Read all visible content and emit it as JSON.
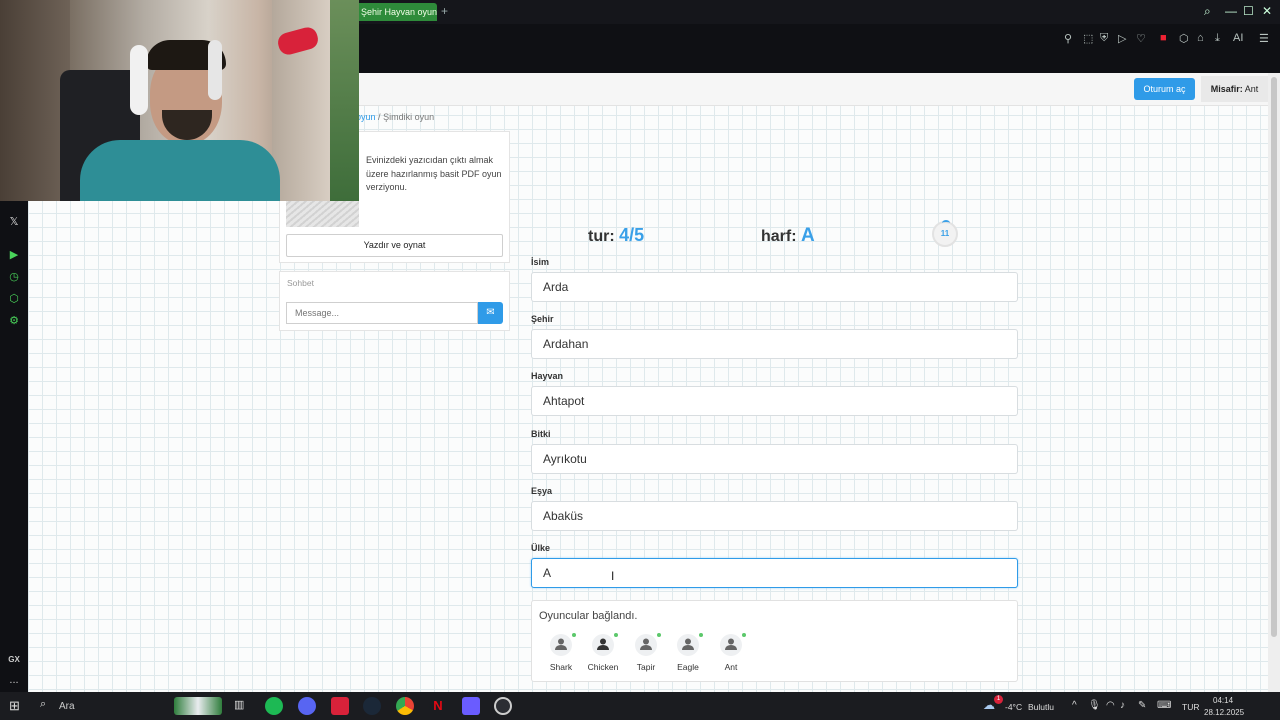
{
  "browser": {
    "tab_title": "Şehir Hayvan oyun",
    "new_tab": "+",
    "toolbar_ai": "AI"
  },
  "header": {
    "login_button": "Oturum aç",
    "guest_label": "Misafir:",
    "guest_name": "Ant"
  },
  "breadcrumb": {
    "link": "oyun",
    "separator": "/",
    "current": "Şimdiki oyun"
  },
  "print_panel": {
    "description": "Evinizdeki yazıcıdan çıktı almak üzere hazırlanmış basit PDF oyun verziyonu.",
    "button": "Yazdır ve oynat"
  },
  "chat": {
    "title": "Sohbet",
    "placeholder": "Message..."
  },
  "game": {
    "round_label": "tur:",
    "round_value": "4/5",
    "letter_label": "harf:",
    "letter_value": "A",
    "timer": "11",
    "fields": [
      {
        "label": "İsim",
        "value": "Arda"
      },
      {
        "label": "Şehir",
        "value": "Ardahan"
      },
      {
        "label": "Hayvan",
        "value": "Ahtapot"
      },
      {
        "label": "Bitki",
        "value": "Ayrıkotu"
      },
      {
        "label": "Eşya",
        "value": "Abaküs"
      },
      {
        "label": "Ülke",
        "value": "A"
      }
    ],
    "players_message": "Oyuncular bağlandı.",
    "players": [
      "Shark",
      "Chicken",
      "Tapir",
      "Eagle",
      "Ant"
    ]
  },
  "sidebar": {
    "gx_label": "GX",
    "more": "..."
  },
  "taskbar": {
    "search": "Ara",
    "temperature": "-4°C",
    "weather": "Bulutlu",
    "language": "TUR",
    "time": "04:14",
    "date": "28.12.2025",
    "notification_count": "1"
  },
  "colors": {
    "accent": "#2f9be8",
    "tab_green": "#2e8b3a",
    "sidebar_green": "#49d35a"
  }
}
